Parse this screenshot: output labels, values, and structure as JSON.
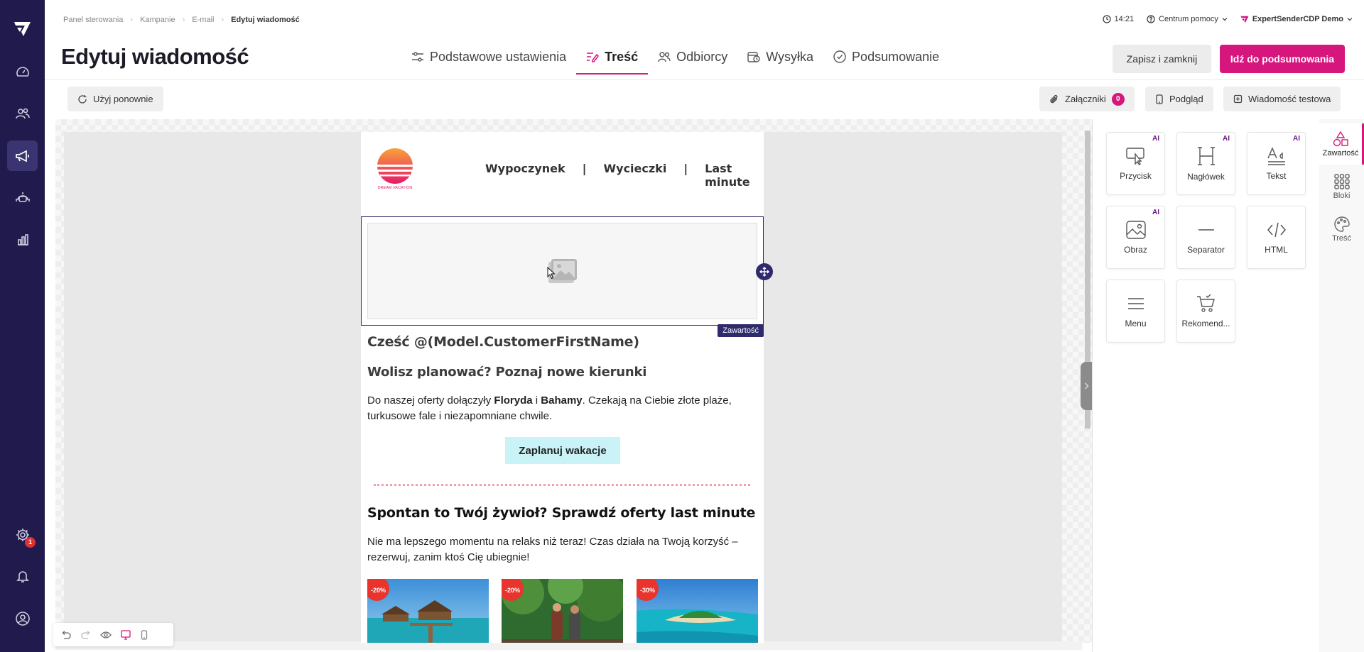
{
  "breadcrumb": [
    "Panel sterowania",
    "Kampanie",
    "E-mail",
    "Edytuj wiadomość"
  ],
  "header": {
    "time": "14:21",
    "help": "Centrum pomocy",
    "account": "ExpertSenderCDP Demo",
    "title": "Edytuj wiadomość",
    "save_label": "Zapisz i zamknij",
    "primary_label": "Idź do podsumowania"
  },
  "steps": [
    {
      "label": "Podstawowe ustawienia",
      "icon": "sliders-icon"
    },
    {
      "label": "Treść",
      "icon": "edit-lines-icon",
      "active": true
    },
    {
      "label": "Odbiorcy",
      "icon": "users-icon"
    },
    {
      "label": "Wysyłka",
      "icon": "calendar-clock-icon"
    },
    {
      "label": "Podsumowanie",
      "icon": "check-circle-icon"
    }
  ],
  "toolbar": {
    "reuse_label": "Użyj ponownie",
    "attachments_label": "Załączniki",
    "attachments_count": "0",
    "preview_label": "Podgląd",
    "test_label": "Wiadomość testowa"
  },
  "leftnav": {
    "settings_badge": "1"
  },
  "email": {
    "logo_text": "DREAM VACATION",
    "nav": [
      "Wypoczynek",
      "|",
      "Wycieczki",
      "|",
      "Last minute"
    ],
    "block_tag": "Zawartość",
    "greeting": "Cześć @(Model.CustomerFirstName)",
    "heading1": "Wolisz planować? Poznaj nowe kierunki",
    "para1_pre": "Do naszej oferty dołączyły ",
    "para1_b1": "Floryda",
    "para1_mid": " i ",
    "para1_b2": "Bahamy",
    "para1_post": ". Czekają na Ciebie złote plaże, turkusowe fale i niezapomniane chwile.",
    "cta": "Zaplanuj wakacje",
    "heading2": "Spontan to Twój żywioł? Sprawdź oferty last minute",
    "para2": "Nie ma lepszego momentu na relaks niż teraz! Czas działa na Twoją korzyść – rezerwuj, zanim ktoś Cię ubiegnie!",
    "offers": [
      {
        "discount": "-20%",
        "scene": "overwater-bungalow"
      },
      {
        "discount": "-20%",
        "scene": "jungle-hikers"
      },
      {
        "discount": "-30%",
        "scene": "tropical-island"
      }
    ]
  },
  "panel": {
    "tiles": [
      {
        "label": "Przycisk",
        "icon": "button-cursor-icon",
        "ai": "AI"
      },
      {
        "label": "Nagłówek",
        "icon": "heading-icon",
        "ai": "AI"
      },
      {
        "label": "Tekst",
        "icon": "text-icon",
        "ai": "AI"
      },
      {
        "label": "Obraz",
        "icon": "image-icon",
        "ai": "AI"
      },
      {
        "label": "Separator",
        "icon": "separator-icon"
      },
      {
        "label": "HTML",
        "icon": "code-icon"
      },
      {
        "label": "Menu",
        "icon": "menu-icon"
      },
      {
        "label": "Rekomend...",
        "icon": "cart-icon"
      }
    ],
    "tabs": [
      {
        "label": "Zawartość",
        "icon": "shapes-icon",
        "active": true
      },
      {
        "label": "Bloki",
        "icon": "grid-icon"
      },
      {
        "label": "Treść",
        "icon": "palette-icon"
      }
    ]
  },
  "colors": {
    "sidebar": "#201a4d",
    "accent": "#d6157d",
    "selection": "#2e2a6b",
    "cta_bg": "#c9f3f7",
    "discount": "#e8342c"
  }
}
